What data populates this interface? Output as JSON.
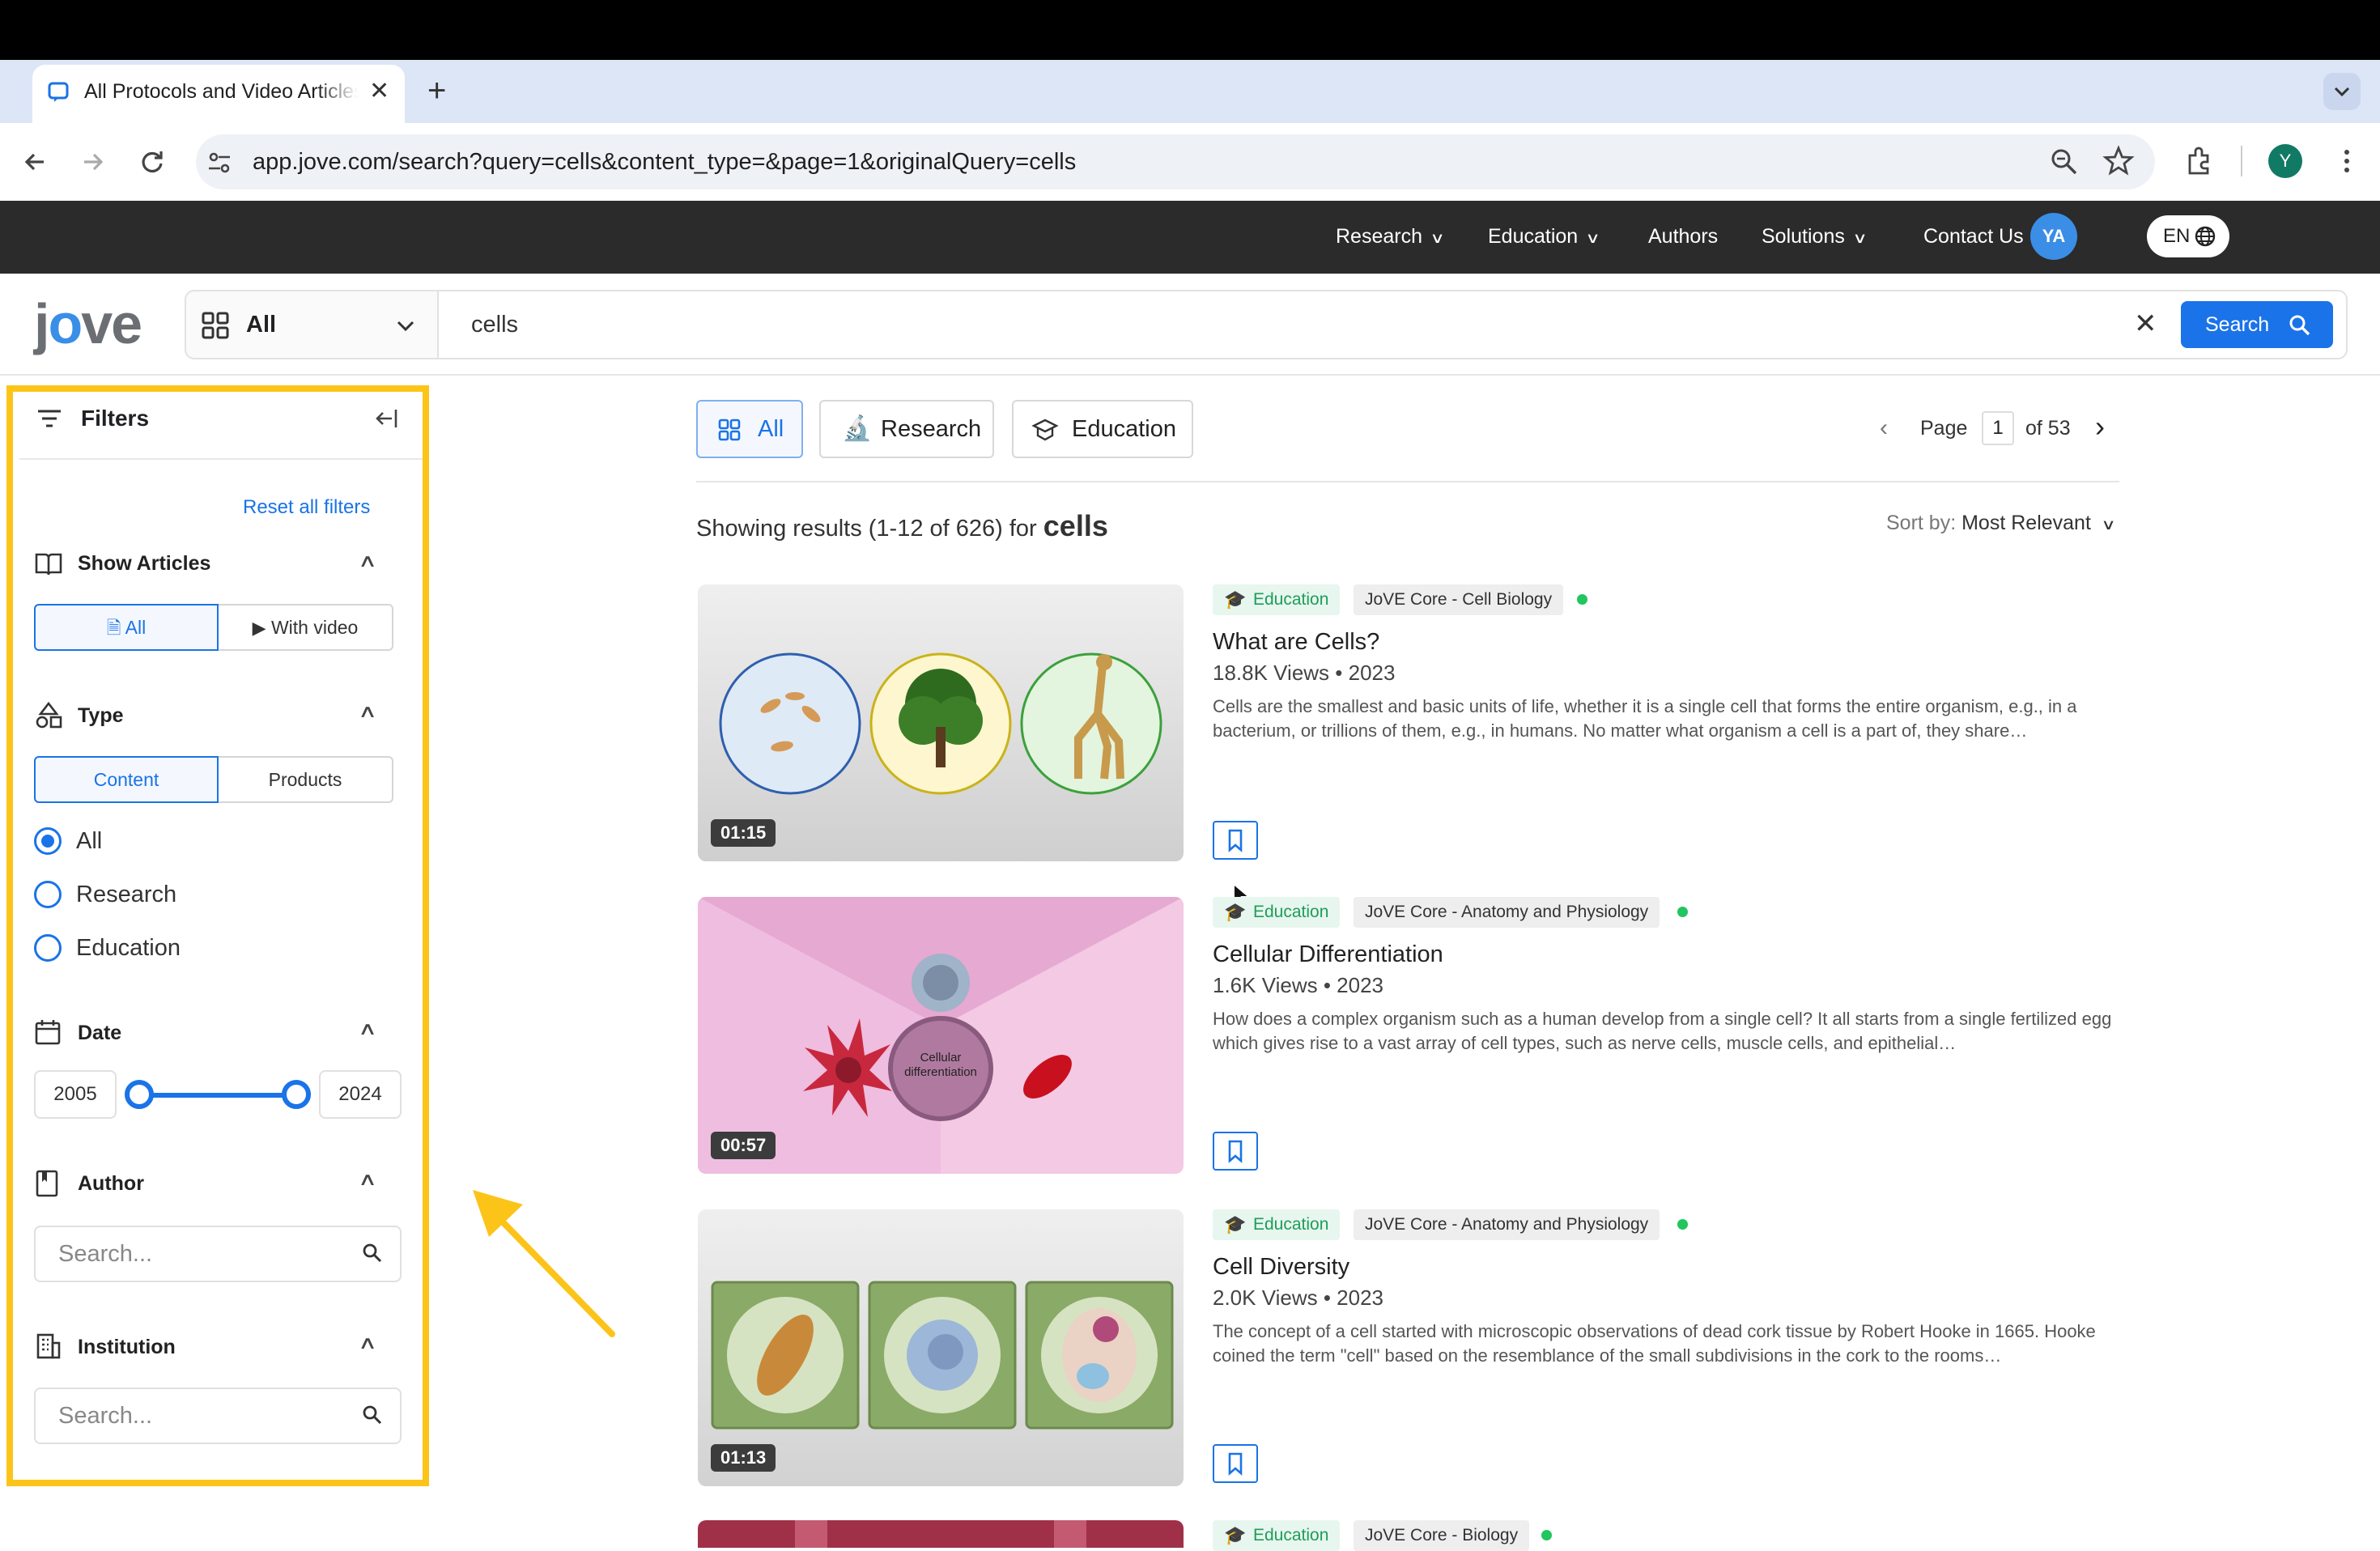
{
  "browser": {
    "tab_title": "All Protocols and Video Articles",
    "url": "app.jove.com/search?query=cells&content_type=&page=1&originalQuery=cells",
    "profile_initial": "Y"
  },
  "site_nav": {
    "items": [
      "Research",
      "Education",
      "Authors",
      "Solutions",
      "Contact Us"
    ],
    "user_initials": "YA",
    "language": "EN"
  },
  "search": {
    "logo": "jove",
    "scope": "All",
    "query": "cells",
    "button_label": "Search"
  },
  "filters": {
    "title": "Filters",
    "reset_label": "Reset all filters",
    "show_articles": {
      "label": "Show Articles",
      "options": [
        "All",
        "With video"
      ],
      "selected": "All"
    },
    "type": {
      "label": "Type",
      "segments": [
        "Content",
        "Products"
      ],
      "selected_segment": "Content",
      "radio_options": [
        "All",
        "Research",
        "Education"
      ],
      "selected_radio": "All"
    },
    "date": {
      "label": "Date",
      "from": "2005",
      "to": "2024"
    },
    "author": {
      "label": "Author",
      "placeholder": "Search..."
    },
    "institution": {
      "label": "Institution",
      "placeholder": "Search..."
    }
  },
  "results_header": {
    "tabs": [
      "All",
      "Research",
      "Education"
    ],
    "active_tab": "All",
    "page_label": "Page",
    "page_current": "1",
    "page_total_label": "of 53",
    "summary_prefix": "Showing results (1-12 of 626) for",
    "summary_query": "cells",
    "sort_label": "Sort by:",
    "sort_value": "Most Relevant"
  },
  "results": [
    {
      "tag": "Education",
      "collection": "JoVE Core - Cell Biology",
      "title": "What are Cells?",
      "meta": "18.8K Views • 2023",
      "desc": "Cells are the smallest and basic units of life, whether it is a single cell that forms the entire organism, e.g., in a bacterium, or trillions of them, e.g., in humans. No matter what organism a cell is a part of, they share…",
      "duration": "01:15"
    },
    {
      "tag": "Education",
      "collection": "JoVE Core - Anatomy and Physiology",
      "title": "Cellular Differentiation",
      "meta": "1.6K Views • 2023",
      "desc": "How does a complex organism such as a human develop from a single cell? It all starts from a single fertilized egg which gives rise to a vast array of cell types, such as nerve cells, muscle cells, and epithelial…",
      "duration": "00:57",
      "thumb_label": "Cellular differentiation"
    },
    {
      "tag": "Education",
      "collection": "JoVE Core - Anatomy and Physiology",
      "title": "Cell Diversity",
      "meta": "2.0K Views • 2023",
      "desc": "The concept of a cell started with microscopic observations of dead cork tissue by Robert Hooke in 1665. Hooke coined the term \"cell\" based on the resemblance of the small subdivisions in the cork to the rooms…",
      "duration": "01:13"
    },
    {
      "tag": "Education",
      "collection": "JoVE Core - Biology"
    }
  ],
  "colors": {
    "accent": "#1a73e8",
    "highlight": "#fcc419",
    "nav_bg": "#2b2b2b",
    "education_green": "#1e9d5a"
  }
}
